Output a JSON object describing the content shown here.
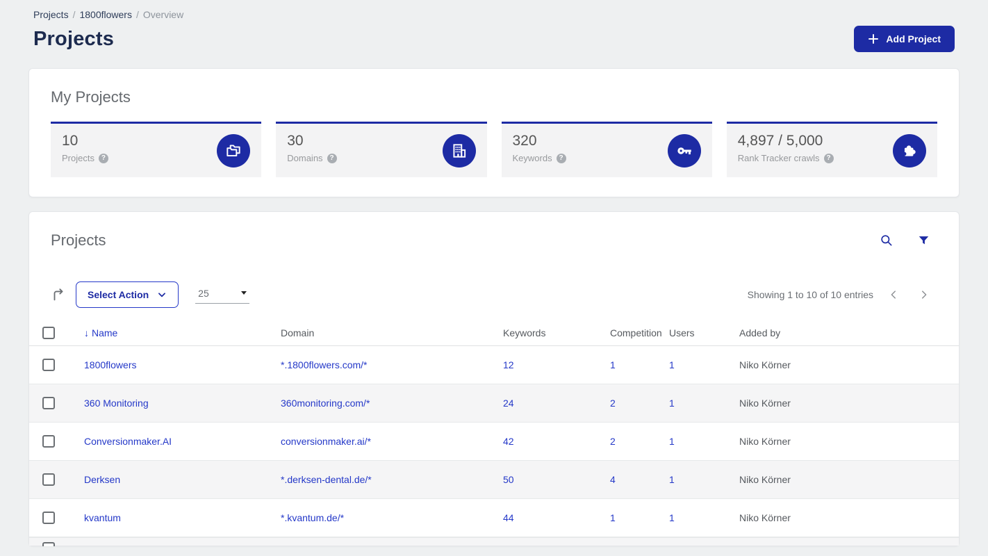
{
  "colors": {
    "brand_blue": "#1d2ba4",
    "link_blue": "#2438c8",
    "title_navy": "#1d2b4f",
    "page_bg": "#eef0f1",
    "tile_bg": "#f3f3f4",
    "stripe_bg": "#f5f5f6"
  },
  "breadcrumb": {
    "items": [
      {
        "label": "Projects"
      },
      {
        "label": "1800flowers"
      },
      {
        "label": "Overview"
      }
    ],
    "separator": "/"
  },
  "page": {
    "title": "Projects"
  },
  "header": {
    "add_project_label": "Add Project"
  },
  "icons": {
    "help_glyph": "?",
    "sort_down_glyph": "↓"
  },
  "my_projects": {
    "title": "My Projects",
    "stats": [
      {
        "value": "10",
        "label": "Projects",
        "icon": "projects-folders-icon"
      },
      {
        "value": "30",
        "label": "Domains",
        "icon": "building-icon"
      },
      {
        "value": "320",
        "label": "Keywords",
        "icon": "key-icon"
      },
      {
        "value": "4,897 / 5,000",
        "label": "Rank Tracker crawls",
        "icon": "puzzle-icon"
      }
    ]
  },
  "projects_table": {
    "title": "Projects",
    "toolbar": {
      "select_action_label": "Select Action",
      "page_size_value": "25",
      "showing_text": "Showing 1 to 10 of 10 entries"
    },
    "columns": {
      "name": "Name",
      "domain": "Domain",
      "keywords": "Keywords",
      "competition": "Competition",
      "users": "Users",
      "added_by": "Added by"
    },
    "sorted_column": "Name",
    "sort_direction": "descending",
    "rows": [
      {
        "name": "1800flowers",
        "domain": "*.1800flowers.com/*",
        "keywords": "12",
        "competition": "1",
        "users": "1",
        "added_by": "Niko Körner"
      },
      {
        "name": "360 Monitoring",
        "domain": "360monitoring.com/*",
        "keywords": "24",
        "competition": "2",
        "users": "1",
        "added_by": "Niko Körner"
      },
      {
        "name": "Conversionmaker.AI",
        "domain": "conversionmaker.ai/*",
        "keywords": "42",
        "competition": "2",
        "users": "1",
        "added_by": "Niko Körner"
      },
      {
        "name": "Derksen",
        "domain": "*.derksen-dental.de/*",
        "keywords": "50",
        "competition": "4",
        "users": "1",
        "added_by": "Niko Körner"
      },
      {
        "name": "kvantum",
        "domain": "*.kvantum.de/*",
        "keywords": "44",
        "competition": "1",
        "users": "1",
        "added_by": "Niko Körner"
      }
    ]
  }
}
